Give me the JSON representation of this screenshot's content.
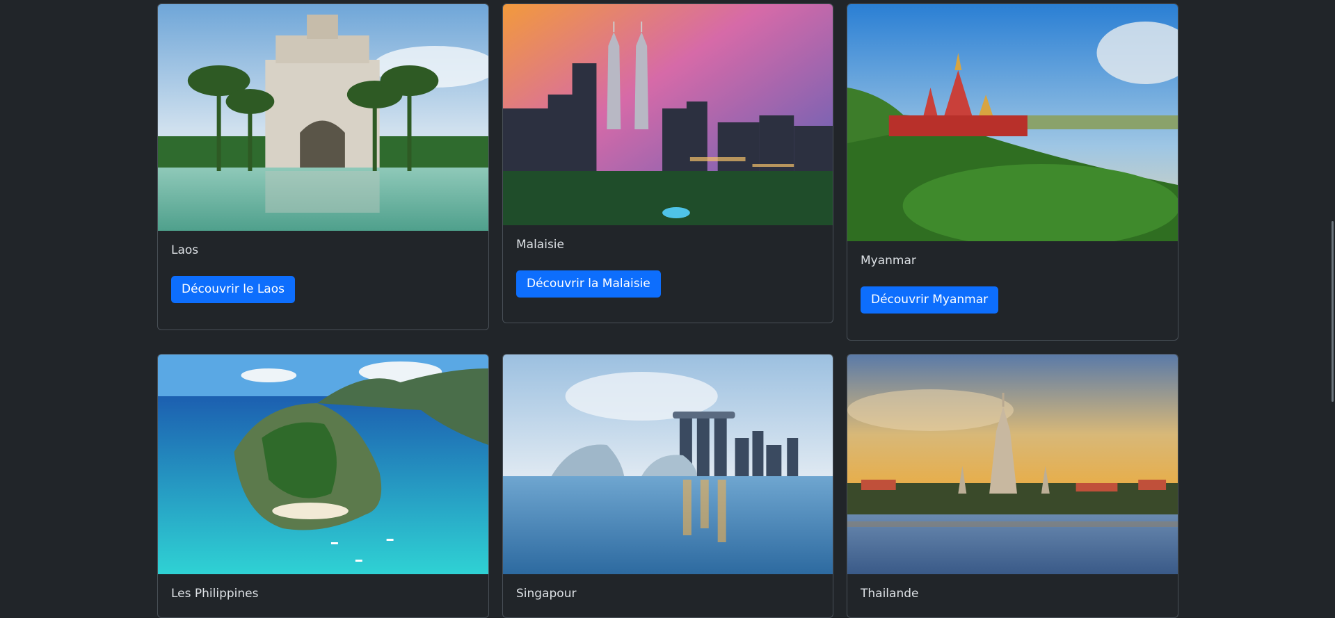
{
  "destinations": [
    {
      "name": "Laos",
      "button": "Découvrir le Laos"
    },
    {
      "name": "Malaisie",
      "button": "Découvrir la Malaisie"
    },
    {
      "name": "Myanmar",
      "button": "Découvrir Myanmar"
    },
    {
      "name": "Les Philippines"
    },
    {
      "name": "Singapour"
    },
    {
      "name": "Thailande"
    }
  ],
  "colors": {
    "background": "#212529",
    "card_border": "#495057",
    "button": "#0d6efd",
    "text": "#dee2e6"
  }
}
